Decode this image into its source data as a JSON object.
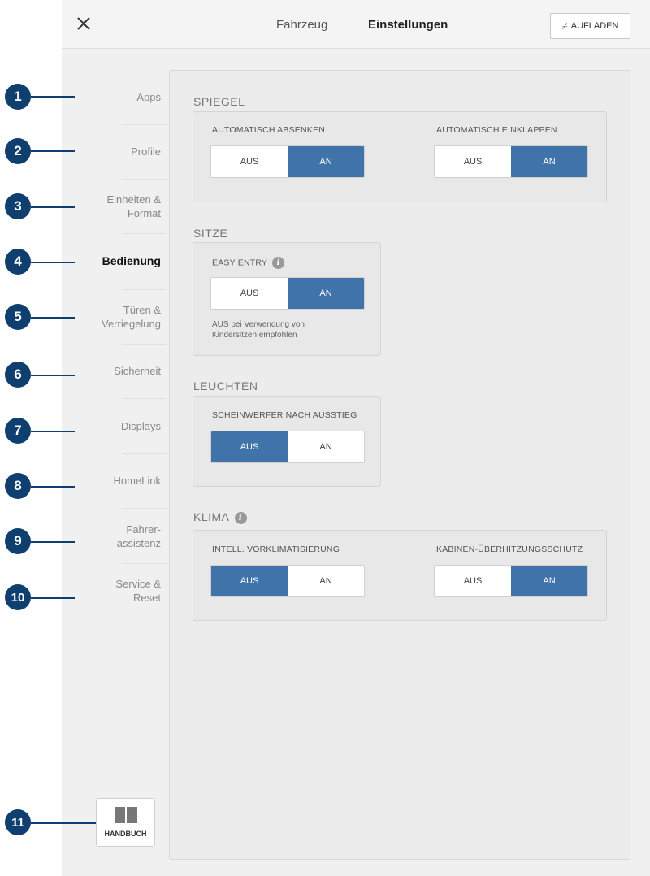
{
  "header": {
    "tab_vehicle": "Fahrzeug",
    "tab_settings": "Einstellungen",
    "charge_label": "AUFLADEN"
  },
  "sidebar": {
    "items": [
      {
        "label": "Apps"
      },
      {
        "label": "Profile"
      },
      {
        "label": "Einheiten &",
        "label2": "Format"
      },
      {
        "label": "Bedienung",
        "active": true
      },
      {
        "label": "Türen &",
        "label2": "Verriegelung"
      },
      {
        "label": "Sicherheit"
      },
      {
        "label": "Displays"
      },
      {
        "label": "HomeLink"
      },
      {
        "label": "Fahrer-",
        "label2": "assistenz"
      },
      {
        "label": "Service &",
        "label2": "Reset"
      }
    ],
    "manual_label": "HANDBUCH"
  },
  "callouts": [
    "1",
    "2",
    "3",
    "4",
    "5",
    "6",
    "7",
    "8",
    "9",
    "10",
    "11"
  ],
  "sections": {
    "mirrors": {
      "title": "SPIEGEL",
      "auto_dip": {
        "label": "AUTOMATISCH ABSENKEN",
        "off": "AUS",
        "on": "AN",
        "selected": "AN"
      },
      "auto_fold": {
        "label": "AUTOMATISCH EINKLAPPEN",
        "off": "AUS",
        "on": "AN",
        "selected": "AN"
      }
    },
    "seats": {
      "title": "SITZE",
      "easy_entry": {
        "label": "EASY ENTRY",
        "off": "AUS",
        "on": "AN",
        "selected": "AN"
      },
      "note_line1": "AUS bei Verwendung von",
      "note_line2": "Kindersitzen empfohlen"
    },
    "lights": {
      "title": "LEUCHTEN",
      "headlights_after_exit": {
        "label": "SCHEINWERFER NACH AUSSTIEG",
        "off": "AUS",
        "on": "AN",
        "selected": "AUS"
      }
    },
    "climate": {
      "title": "KLIMA",
      "smart_precondition": {
        "label": "INTELL. VORKLIMATISIERUNG",
        "off": "AUS",
        "on": "AN",
        "selected": "AUS"
      },
      "cabin_overheat": {
        "label": "KABINEN-ÜBERHITZUNGSSCHUTZ",
        "off": "AUS",
        "on": "AN",
        "selected": "AN"
      }
    }
  },
  "colors": {
    "accent": "#3f73a9",
    "callout": "#0f3f6e"
  }
}
